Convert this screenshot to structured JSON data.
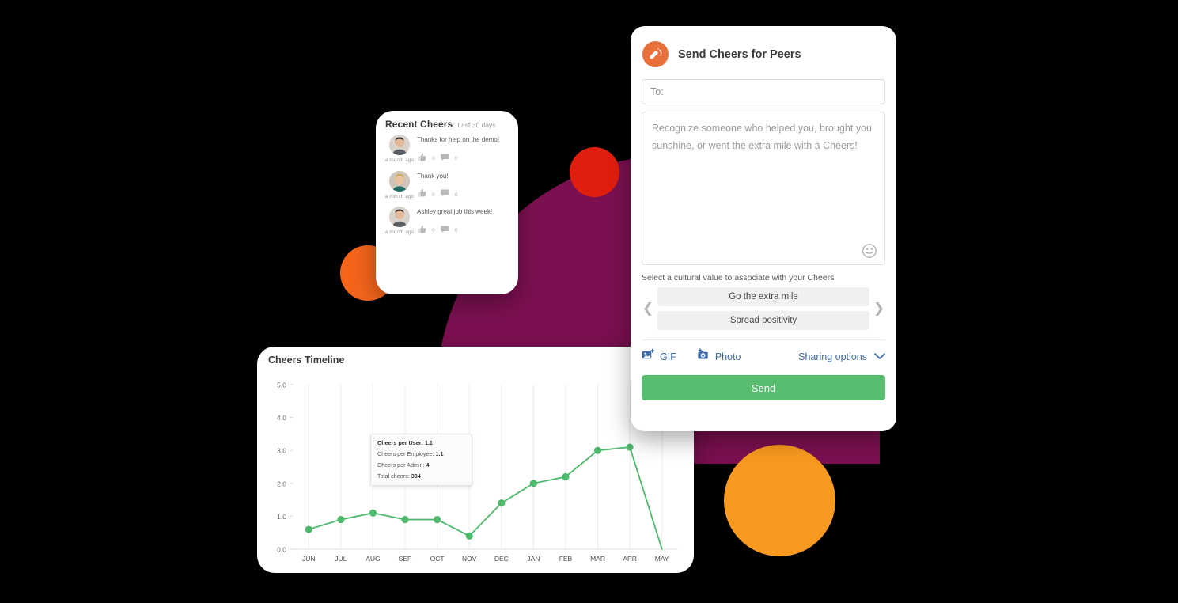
{
  "recent_cheers": {
    "title": "Recent Cheers",
    "subtitle": "Last 30 days",
    "items": [
      {
        "message": "Thanks for help on the demo!",
        "time": "a month ago",
        "likes": "0",
        "comments": "0",
        "avatar": "avatar-man-dark-hair"
      },
      {
        "message": "Thank you!",
        "time": "a month ago",
        "likes": "0",
        "comments": "0",
        "avatar": "avatar-woman-blonde"
      },
      {
        "message": "Ashley great job this week!",
        "time": "a month ago",
        "likes": "0",
        "comments": "0",
        "avatar": "avatar-man-dark-hair"
      }
    ]
  },
  "timeline": {
    "title": "Cheers Timeline",
    "tooltip": {
      "line1_label": "Cheers per User:",
      "line1_value": "1.1",
      "line2_label": "Cheers per Employee:",
      "line2_value": "1.1",
      "line3_label": "Cheers per Admin:",
      "line3_value": "4",
      "line4_label": "Total cheers:",
      "line4_value": "394"
    }
  },
  "chart_data": {
    "type": "line",
    "title": "Cheers Timeline",
    "categories": [
      "JUN",
      "JUL",
      "AUG",
      "SEP",
      "OCT",
      "NOV",
      "DEC",
      "JAN",
      "FEB",
      "MAR",
      "APR",
      "MAY"
    ],
    "series": [
      {
        "name": "Cheers per User",
        "values": [
          0.6,
          0.9,
          1.1,
          0.9,
          0.9,
          0.4,
          1.4,
          2.0,
          2.2,
          3.0,
          3.1,
          0.0
        ]
      }
    ],
    "ylim": [
      0,
      5
    ],
    "yticks": [
      "0.0",
      "1.0",
      "2.0",
      "3.0",
      "4.0",
      "5.0"
    ],
    "xlabel": "",
    "ylabel": "",
    "grid": "vertical",
    "line_color": "#4CB96B",
    "legend": "none"
  },
  "cheers_panel": {
    "title": "Send Cheers for Peers",
    "to_placeholder": "To:",
    "message_placeholder": "Recognize someone who helped you, brought you sunshine, or went the extra mile with a Cheers!",
    "cultural_label": "Select a cultural value to associate with your Cheers",
    "values": [
      "Go the extra mile",
      "Spread positivity"
    ],
    "gif_label": "GIF",
    "photo_label": "Photo",
    "sharing_label": "Sharing options",
    "send_label": "Send"
  },
  "colors": {
    "brand_orange": "#E8703A",
    "send_green": "#58BD6E",
    "link_blue": "#3F6BA8",
    "magenta": "#7B1050",
    "red": "#E01E0E",
    "orange": "#F89A20",
    "chart_green": "#4CB96B"
  }
}
